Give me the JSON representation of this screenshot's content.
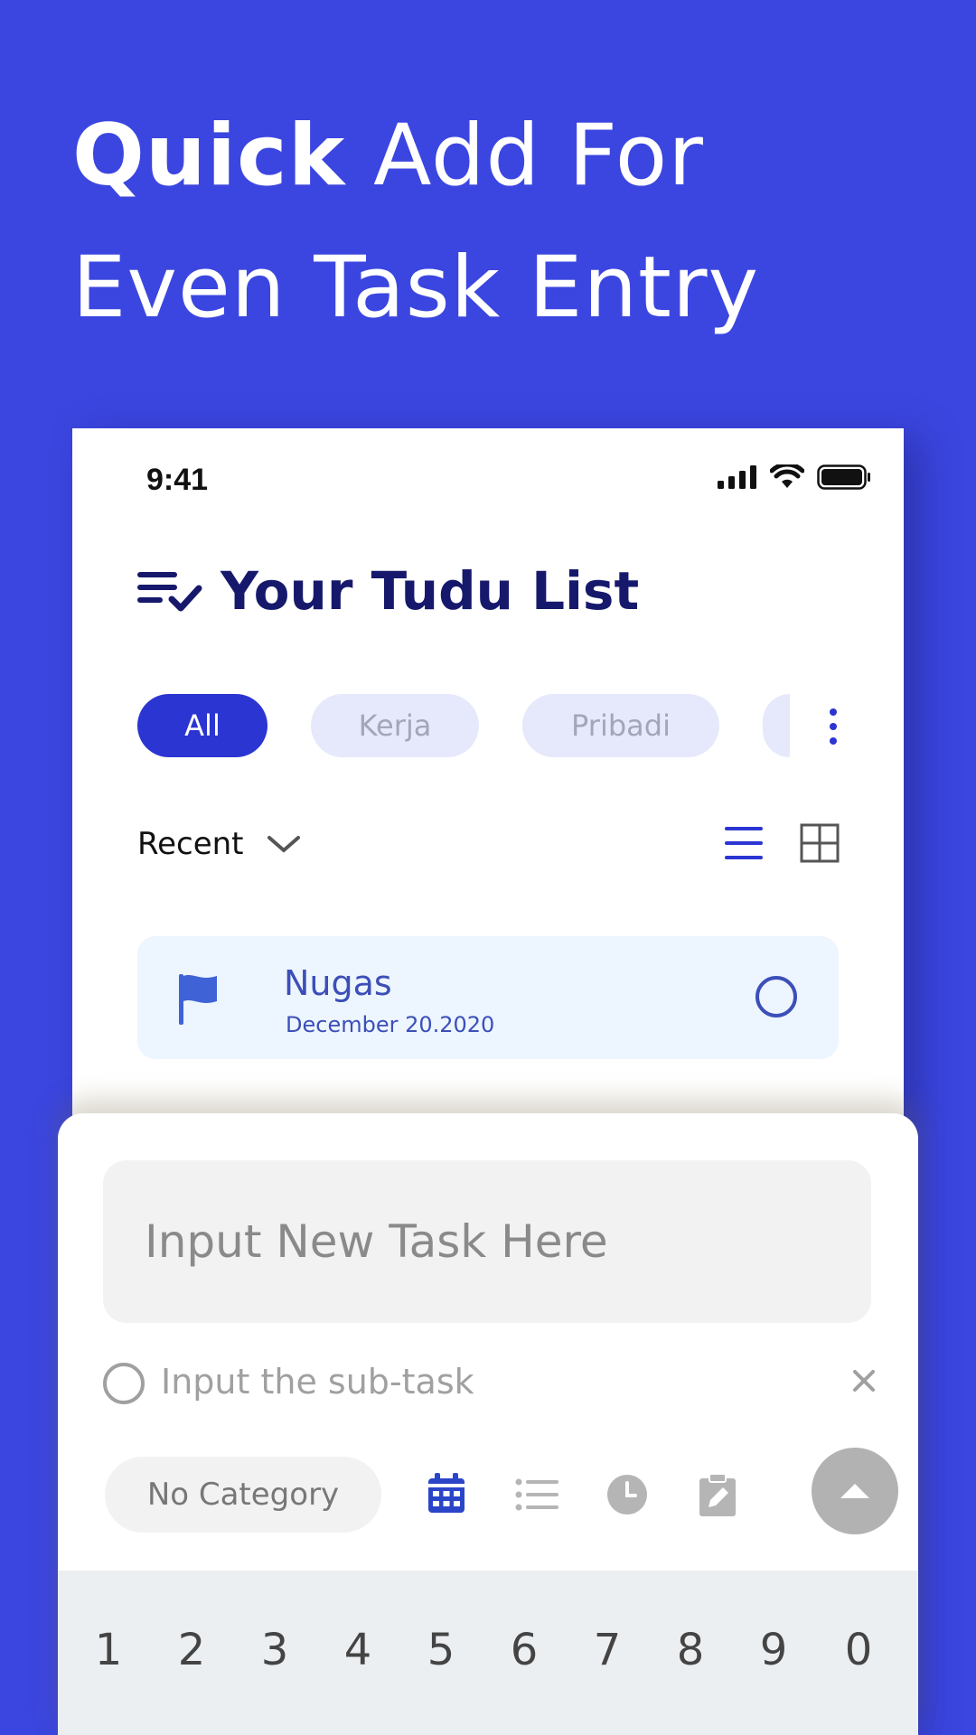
{
  "headline": {
    "bold": "Quick",
    "rest_line1": " Add For",
    "line2": "Even Task Entry"
  },
  "status": {
    "time": "9:41"
  },
  "app": {
    "title": "Your Tudu List"
  },
  "filters": {
    "chips": [
      "All",
      "Kerja",
      "Pribadi"
    ],
    "active": "All"
  },
  "sort": {
    "label": "Recent"
  },
  "tasks": [
    {
      "title": "Nugas",
      "date": "December 20.2020"
    }
  ],
  "quick_add": {
    "task_placeholder": "Input New Task Here",
    "subtask_placeholder": "Input the sub-task",
    "category_label": "No Category"
  },
  "keyboard": {
    "number_row": [
      "1",
      "2",
      "3",
      "4",
      "5",
      "6",
      "7",
      "8",
      "9",
      "0"
    ]
  },
  "colors": {
    "background": "#3b46e0",
    "accent": "#2b35d2",
    "title": "#16196b",
    "task_card": "#edf5fe"
  },
  "icons": [
    "signal-icon",
    "wifi-icon",
    "battery-icon",
    "checklist-icon",
    "more-vertical-icon",
    "chevron-down-icon",
    "list-view-icon",
    "grid-view-icon",
    "flag-icon",
    "circle-check-icon",
    "close-icon",
    "calendar-icon",
    "subtask-list-icon",
    "clock-icon",
    "note-icon",
    "chevron-up-icon"
  ]
}
